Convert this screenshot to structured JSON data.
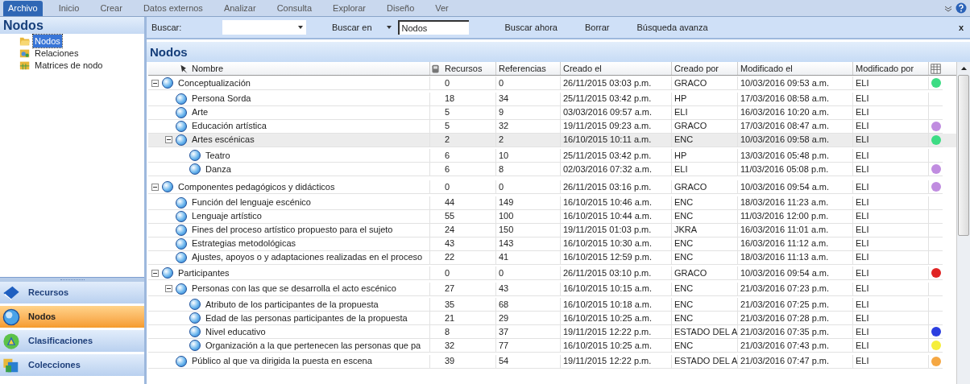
{
  "menu": [
    {
      "label": "Archivo",
      "selected": true
    },
    {
      "label": "Inicio",
      "selected": false
    },
    {
      "label": "Crear",
      "selected": false
    },
    {
      "label": "Datos externos",
      "selected": false
    },
    {
      "label": "Analizar",
      "selected": false
    },
    {
      "label": "Consulta",
      "selected": false
    },
    {
      "label": "Explorar",
      "selected": false
    },
    {
      "label": "Diseño",
      "selected": false
    },
    {
      "label": "Ver",
      "selected": false
    }
  ],
  "sidebar": {
    "title": "Nodos",
    "items": [
      {
        "label": "Nodos",
        "kind": "open-folder",
        "selected": true
      },
      {
        "label": "Relaciones",
        "kind": "relations",
        "selected": false
      },
      {
        "label": "Matrices de nodo",
        "kind": "matrix",
        "selected": false
      }
    ],
    "nav": [
      {
        "label": "Recursos",
        "kind": "book",
        "selected": false
      },
      {
        "label": "Nodos",
        "kind": "node",
        "selected": true
      },
      {
        "label": "Clasificaciones",
        "kind": "classify",
        "selected": false
      },
      {
        "label": "Colecciones",
        "kind": "collections",
        "selected": false
      }
    ]
  },
  "search": {
    "label": "Buscar:",
    "search_in_label": "Buscar en",
    "search_in_value": "Nodos",
    "buttons": [
      "Buscar ahora",
      "Borrar",
      "Búsqueda avanza"
    ],
    "close": "x"
  },
  "table": {
    "title": "Nodos",
    "columns": [
      "Nombre",
      "Recursos",
      "Referencias",
      "Creado el",
      "Creado por",
      "Modificado el",
      "Modificado por"
    ],
    "rows": [
      {
        "cells": [
          "Conceptualización",
          "0",
          "0",
          "26/11/2015 03:03 p.m.",
          "GRACO",
          "10/03/2016 09:53 a.m.",
          "ELI"
        ],
        "color": "#3ddc84",
        "selected": false,
        "expanded": true,
        "children": [
          {
            "cells": [
              "Persona Sorda",
              "18",
              "34",
              "25/11/2015 03:42 p.m.",
              "HP",
              "17/03/2016 08:58 a.m.",
              "ELI"
            ],
            "selected": false
          },
          {
            "cells": [
              "Arte",
              "5",
              "9",
              "03/03/2016 09:57 a.m.",
              "ELI",
              "16/03/2016 10:20 a.m.",
              "ELI"
            ],
            "selected": false
          },
          {
            "cells": [
              "Educación artística",
              "5",
              "32",
              "19/11/2015 09:23 a.m.",
              "GRACO",
              "17/03/2016 08:47 a.m.",
              "ELI"
            ],
            "color": "#c08ce0",
            "selected": false
          },
          {
            "cells": [
              "Artes escénicas",
              "2",
              "2",
              "16/10/2015 10:11 a.m.",
              "ENC",
              "10/03/2016 09:58 a.m.",
              "ELI"
            ],
            "color": "#3ddc84",
            "selected": true,
            "expanded": true,
            "children": [
              {
                "cells": [
                  "Teatro",
                  "6",
                  "10",
                  "25/11/2015 03:42 p.m.",
                  "HP",
                  "13/03/2016 05:48 p.m.",
                  "ELI"
                ],
                "selected": false
              },
              {
                "cells": [
                  "Danza",
                  "6",
                  "8",
                  "02/03/2016 07:32 a.m.",
                  "ELI",
                  "11/03/2016 05:08 p.m.",
                  "ELI"
                ],
                "color": "#c08ce0",
                "selected": false
              }
            ]
          }
        ]
      },
      {
        "cells": [
          "Componentes pedagógicos y didácticos",
          "0",
          "0",
          "26/11/2015 03:16 p.m.",
          "GRACO",
          "10/03/2016 09:54 a.m.",
          "ELI"
        ],
        "color": "#c08ce0",
        "selected": false,
        "expanded": true,
        "children": [
          {
            "cells": [
              "Función del lenguaje escénico",
              "44",
              "149",
              "16/10/2015 10:46 a.m.",
              "ENC",
              "18/03/2016 11:23 a.m.",
              "ELI"
            ],
            "selected": false
          },
          {
            "cells": [
              "Lenguaje artístico",
              "55",
              "100",
              "16/10/2015 10:44 a.m.",
              "ENC",
              "11/03/2016 12:00 p.m.",
              "ELI"
            ],
            "selected": false
          },
          {
            "cells": [
              "Fines del proceso artístico propuesto para el sujeto",
              "24",
              "150",
              "19/11/2015 01:03 p.m.",
              "JKRA",
              "16/03/2016 11:01 a.m.",
              "ELI"
            ],
            "selected": false
          },
          {
            "cells": [
              "Estrategias metodológicas",
              "43",
              "143",
              "16/10/2015 10:30 a.m.",
              "ENC",
              "16/03/2016 11:12 a.m.",
              "ELI"
            ],
            "selected": false
          },
          {
            "cells": [
              "Ajustes, apoyos o y adaptaciones realizadas en el proceso",
              "22",
              "41",
              "16/10/2015 12:59 p.m.",
              "ENC",
              "18/03/2016 11:13 a.m.",
              "ELI"
            ],
            "selected": false
          }
        ]
      },
      {
        "cells": [
          "Participantes",
          "0",
          "0",
          "26/11/2015 03:10 p.m.",
          "GRACO",
          "10/03/2016 09:54 a.m.",
          "ELI"
        ],
        "color": "#e02424",
        "selected": false,
        "expanded": true,
        "children": [
          {
            "cells": [
              "Personas con las que se desarrolla el acto escénico",
              "27",
              "43",
              "16/10/2015 10:15 a.m.",
              "ENC",
              "21/03/2016 07:23 p.m.",
              "ELI"
            ],
            "selected": false,
            "expanded": true,
            "children": [
              {
                "cells": [
                  "Atributo de los participantes de la propuesta",
                  "35",
                  "68",
                  "16/10/2015 10:18 a.m.",
                  "ENC",
                  "21/03/2016 07:25 p.m.",
                  "ELI"
                ],
                "selected": false
              },
              {
                "cells": [
                  "Edad de las personas participantes de la propuesta",
                  "21",
                  "29",
                  "16/10/2015 10:25 a.m.",
                  "ENC",
                  "21/03/2016 07:28 p.m.",
                  "ELI"
                ],
                "selected": false
              },
              {
                "cells": [
                  "Nivel educativo",
                  "8",
                  "37",
                  "19/11/2015 12:22 p.m.",
                  "ESTADO DEL A",
                  "21/03/2016 07:35 p.m.",
                  "ELI"
                ],
                "color": "#2b3ee0",
                "selected": false
              },
              {
                "cells": [
                  "Organización a la que pertenecen las personas que pa",
                  "32",
                  "77",
                  "16/10/2015 10:25 a.m.",
                  "ENC",
                  "21/03/2016 07:43 p.m.",
                  "ELI"
                ],
                "color": "#f5ee3a",
                "selected": false
              }
            ]
          },
          {
            "cells": [
              "Público al que va dirigida la puesta en escena",
              "39",
              "54",
              "19/11/2015 12:22 p.m.",
              "ESTADO DEL A",
              "21/03/2016 07:47 p.m.",
              "ELI"
            ],
            "color": "#f5a742",
            "selected": false
          }
        ]
      }
    ]
  }
}
